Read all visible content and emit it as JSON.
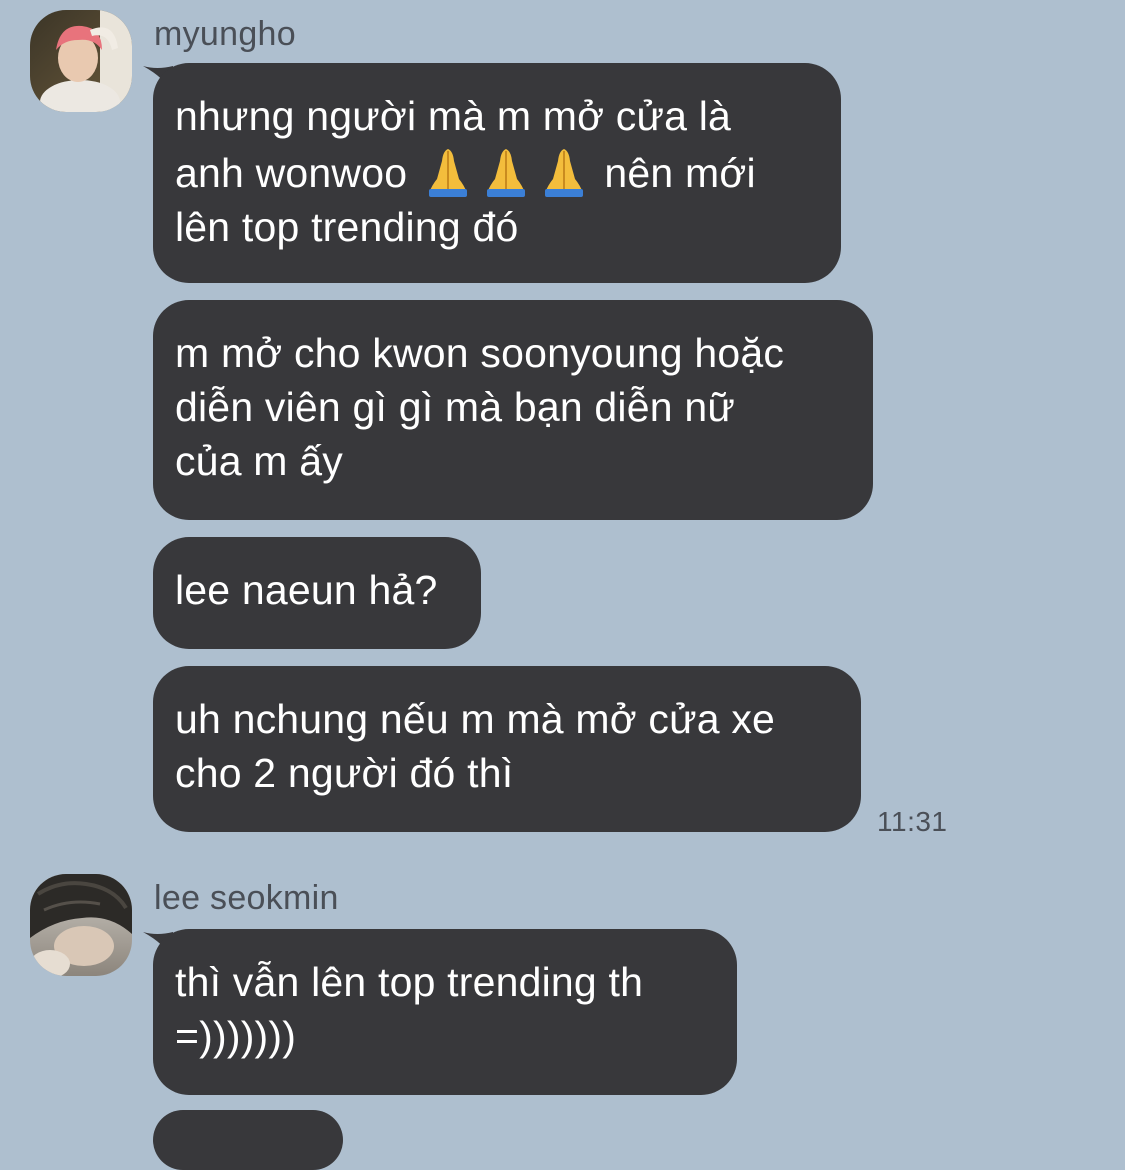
{
  "groups": [
    {
      "sender": "myungho",
      "messages": [
        {
          "segments": [
            "nhưng người mà m mở cửa là\nanh wonwoo ",
            " nên mới\nlên top trending đó"
          ]
        },
        {
          "text": "m mở cho kwon soonyoung hoặc\ndiễn viên gì gì mà bạn diễn nữ\ncủa m ấy"
        },
        {
          "text": "lee naeun hả?"
        },
        {
          "text": "uh nchung nếu m mà mở cửa xe\ncho 2 người đó thì"
        }
      ],
      "timestamp": "11:31"
    },
    {
      "sender": "lee seokmin",
      "messages": [
        {
          "text": "thì vẫn lên top trending th\n=)))))))"
        }
      ]
    }
  ],
  "icons": {
    "emoji": "folded-hands-icon"
  },
  "colors": {
    "background": "#aebfcf",
    "bubble": "#38383b",
    "bubble_text": "#ffffff",
    "meta_text": "#4a4f57"
  }
}
